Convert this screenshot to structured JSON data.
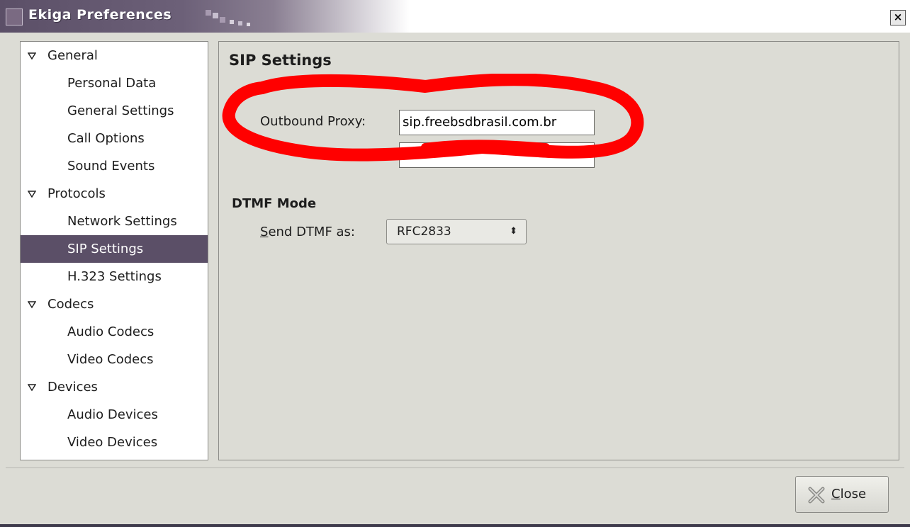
{
  "window": {
    "title": "Ekiga Preferences",
    "close_glyph": "×"
  },
  "sidebar": {
    "items": [
      {
        "label": "General",
        "type": "parent"
      },
      {
        "label": "Personal Data",
        "type": "child"
      },
      {
        "label": "General Settings",
        "type": "child"
      },
      {
        "label": "Call Options",
        "type": "child"
      },
      {
        "label": "Sound Events",
        "type": "child"
      },
      {
        "label": "Protocols",
        "type": "parent"
      },
      {
        "label": "Network Settings",
        "type": "child"
      },
      {
        "label": "SIP Settings",
        "type": "child",
        "selected": true
      },
      {
        "label": "H.323 Settings",
        "type": "child"
      },
      {
        "label": "Codecs",
        "type": "parent"
      },
      {
        "label": "Audio Codecs",
        "type": "child"
      },
      {
        "label": "Video Codecs",
        "type": "child"
      },
      {
        "label": "Devices",
        "type": "parent"
      },
      {
        "label": "Audio Devices",
        "type": "child"
      },
      {
        "label": "Video Devices",
        "type": "child"
      }
    ]
  },
  "main": {
    "title": "SIP Settings",
    "outbound_proxy_label": "Outbound Proxy:",
    "outbound_proxy_value": "sip.freebsdbrasil.com.br",
    "dtmf": {
      "section_title": "DTMF Mode",
      "send_label_first": "S",
      "send_label_rest": "end DTMF as:",
      "selected_value": "RFC2833",
      "chevron": "⬍"
    }
  },
  "footer": {
    "close_label_first": "C",
    "close_label_rest": "lose"
  },
  "colors": {
    "selection": "#5b4f67",
    "annotation": "#ff0000",
    "background": "#dcdcd5"
  },
  "icons": {
    "tree_expander": "triangle-down-icon",
    "close_button": "close-x-icon"
  }
}
